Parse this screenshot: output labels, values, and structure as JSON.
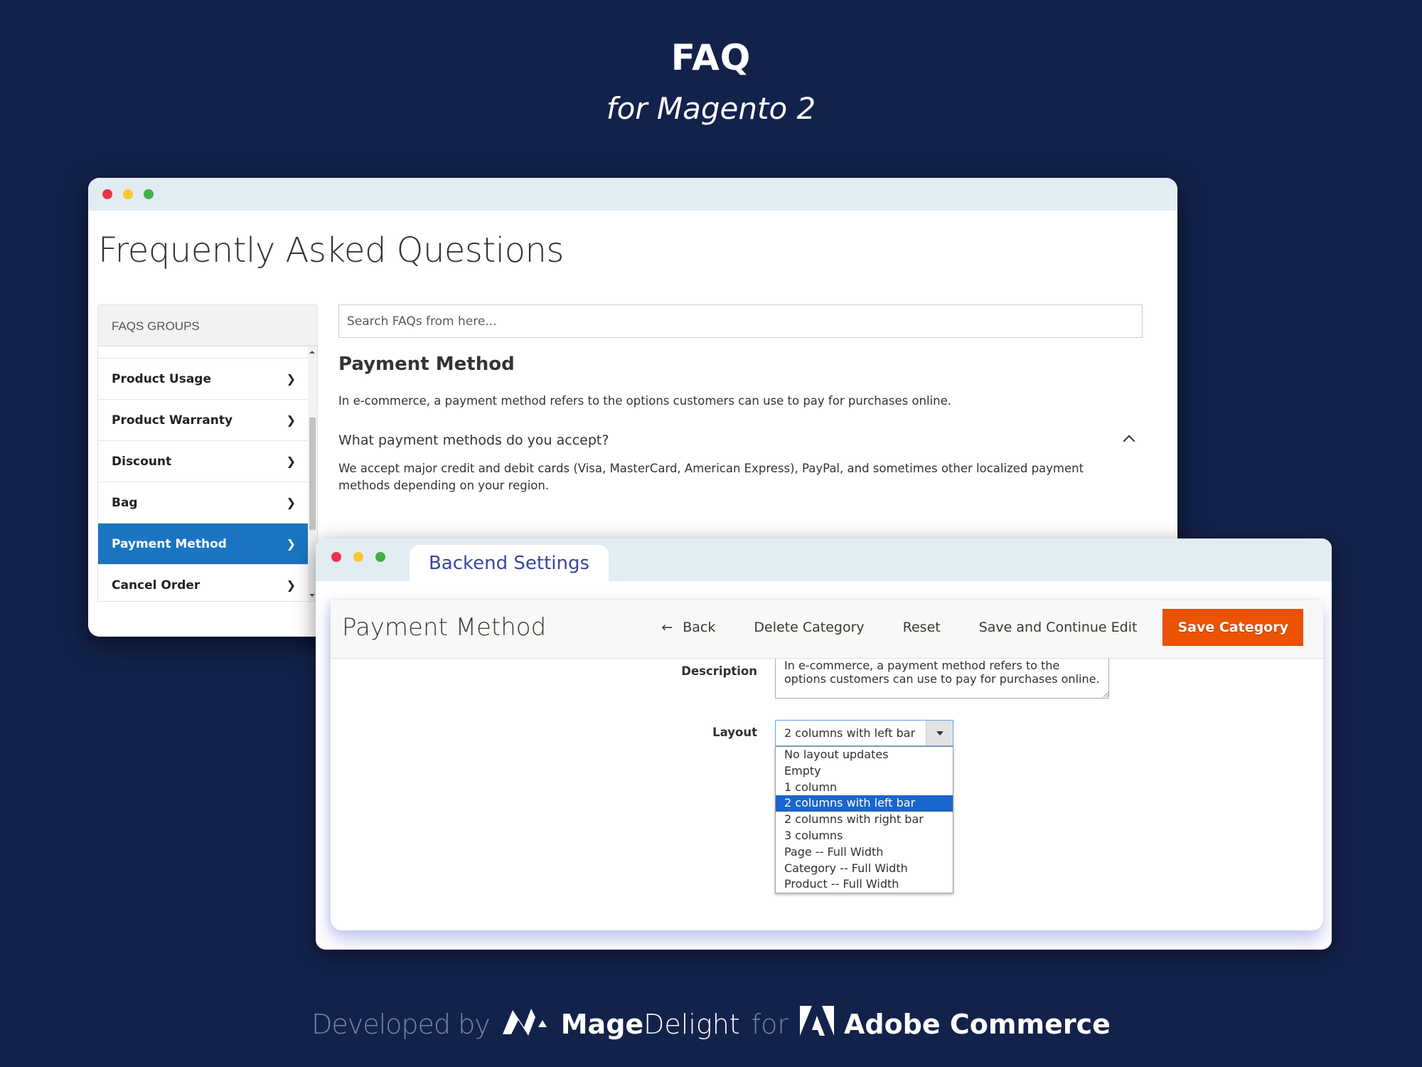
{
  "hero": {
    "title": "FAQ",
    "subtitle": "for Magento 2"
  },
  "frontend": {
    "page_title": "Frequently Asked Questions",
    "sidebar": {
      "header": "FAQS GROUPS",
      "items": [
        {
          "label": "Product Usage",
          "active": false
        },
        {
          "label": "Product Warranty",
          "active": false
        },
        {
          "label": "Discount",
          "active": false
        },
        {
          "label": "Bag",
          "active": false
        },
        {
          "label": "Payment Method",
          "active": true
        },
        {
          "label": "Cancel Order",
          "active": false
        }
      ]
    },
    "search": {
      "placeholder": "Search FAQs from here...",
      "value": ""
    },
    "category": {
      "title": "Payment Method",
      "description": "In e-commerce, a payment method refers to the options customers can use to pay for purchases online."
    },
    "faq": {
      "question": "What payment methods do you accept?",
      "answer": "We accept major credit and debit cards (Visa, MasterCard, American Express), PayPal, and sometimes other localized payment methods depending on your region.",
      "expanded": true
    }
  },
  "backend": {
    "tab_label": "Backend Settings",
    "page_title": "Payment Method",
    "actions": {
      "back": "Back",
      "delete": "Delete Category",
      "reset": "Reset",
      "save_continue": "Save and Continue Edit",
      "save": "Save Category"
    },
    "form": {
      "description_label": "Description",
      "description_value": "In e-commerce, a payment method refers to the options customers can use to pay for purchases online.",
      "layout_label": "Layout",
      "layout_value": "2 columns with left bar",
      "layout_options": [
        "No layout updates",
        "Empty",
        "1 column",
        "2 columns with left bar",
        "2 columns with right bar",
        "3 columns",
        "Page -- Full Width",
        "Category -- Full Width",
        "Product -- Full Width"
      ]
    }
  },
  "footer": {
    "developed_by": "Developed by",
    "brand_bold": "Mage",
    "brand_light": "Delight",
    "for": "for",
    "platform": "Adobe Commerce"
  },
  "colors": {
    "background": "#13224b",
    "active_item": "#1b74c2",
    "primary_button": "#eb5202",
    "tab_text": "#3848a0",
    "selected_option": "#1a66cc"
  }
}
